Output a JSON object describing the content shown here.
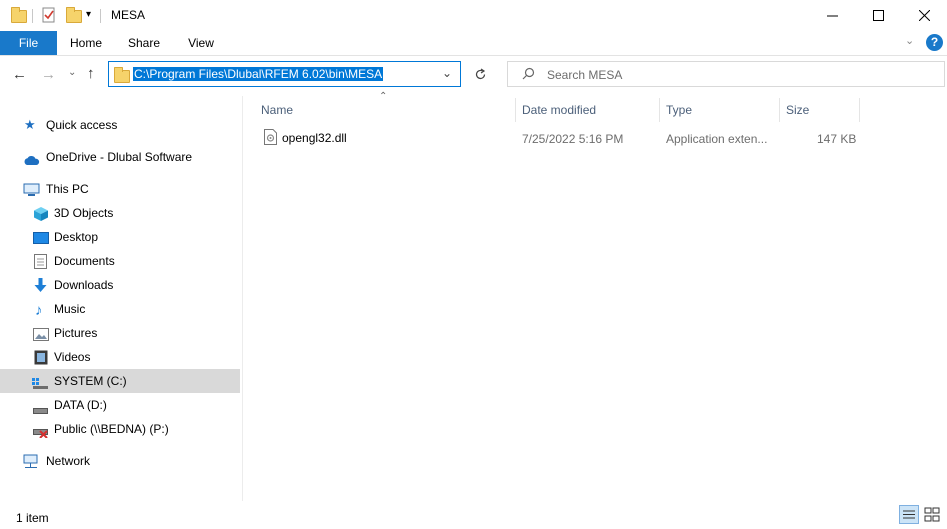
{
  "window": {
    "title": "MESA"
  },
  "ribbon": {
    "tabs": [
      "File",
      "Home",
      "Share",
      "View"
    ]
  },
  "address": {
    "path": "C:\\Program Files\\Dlubal\\RFEM 6.02\\bin\\MESA"
  },
  "search": {
    "placeholder": "Search MESA"
  },
  "nav": {
    "quick_access": "Quick access",
    "onedrive": "OneDrive - Dlubal Software",
    "this_pc": "This PC",
    "items": [
      "3D Objects",
      "Desktop",
      "Documents",
      "Downloads",
      "Music",
      "Pictures",
      "Videos",
      "SYSTEM (C:)",
      "DATA (D:)",
      "Public (\\\\BEDNA) (P:)"
    ],
    "network": "Network"
  },
  "columns": {
    "name": "Name",
    "date_modified": "Date modified",
    "type": "Type",
    "size": "Size"
  },
  "files": [
    {
      "name": "opengl32.dll",
      "date_modified": "7/25/2022 5:16 PM",
      "type": "Application exten...",
      "size": "147 KB"
    }
  ],
  "status": {
    "item_count": "1 item"
  }
}
